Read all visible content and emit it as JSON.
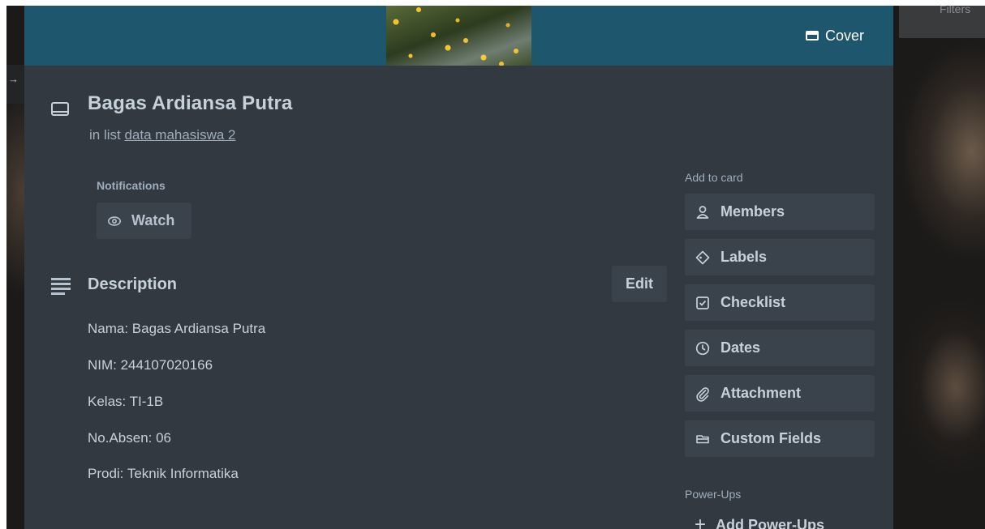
{
  "background": {
    "filters_label": "Filters",
    "left_arrow": "→"
  },
  "cover": {
    "button_label": "Cover",
    "icon": "cover-icon"
  },
  "card": {
    "icon": "card-icon",
    "title": "Bagas Ardiansa Putra",
    "in_list_prefix": "in list",
    "list_name": "data mahasiswa 2"
  },
  "notifications": {
    "label": "Notifications",
    "watch_label": "Watch",
    "watch_icon": "eye-icon"
  },
  "description": {
    "icon": "description-icon",
    "title": "Description",
    "edit_label": "Edit",
    "lines": [
      "Nama: Bagas Ardiansa Putra",
      "NIM: 244107020166",
      "Kelas: TI-1B",
      "No.Absen: 06",
      "Prodi: Teknik Informatika"
    ]
  },
  "sidebar": {
    "add_to_card_label": "Add to card",
    "items": [
      {
        "label": "Members",
        "icon": "person-icon"
      },
      {
        "label": "Labels",
        "icon": "tag-icon"
      },
      {
        "label": "Checklist",
        "icon": "checkbox-icon"
      },
      {
        "label": "Dates",
        "icon": "clock-icon"
      },
      {
        "label": "Attachment",
        "icon": "paperclip-icon"
      },
      {
        "label": "Custom Fields",
        "icon": "custom-fields-icon"
      }
    ],
    "power_ups_label": "Power-Ups",
    "add_power_ups_label": "Add Power-Ups"
  },
  "colors": {
    "modal_bg": "#323940",
    "cover_bg": "#1d566d",
    "button_bg": "#3a424b",
    "text_primary": "#c7d1db",
    "text_subtle": "#9fadbc"
  }
}
